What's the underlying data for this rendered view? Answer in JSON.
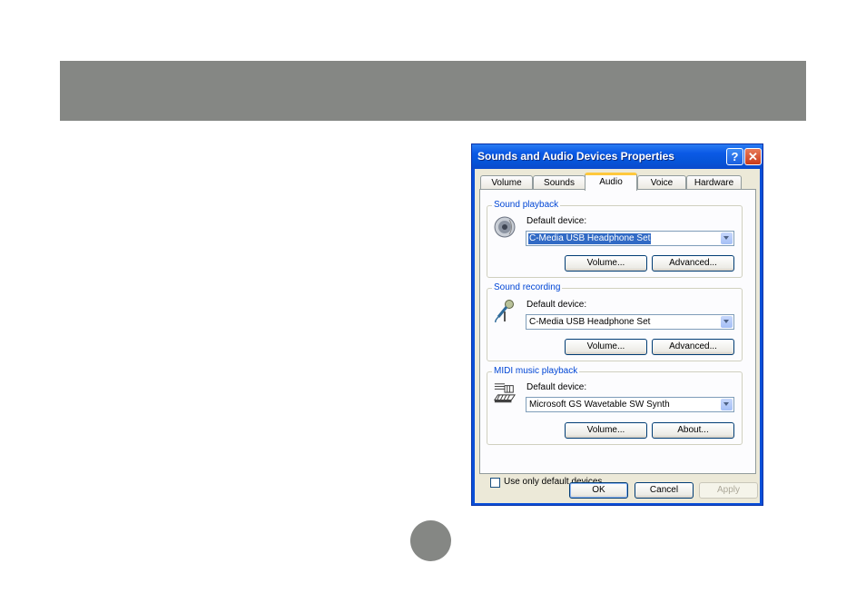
{
  "dialog": {
    "title": "Sounds and Audio Devices Properties",
    "help_label": "?",
    "close_label": "✕",
    "tabs": [
      "Volume",
      "Sounds",
      "Audio",
      "Voice",
      "Hardware"
    ],
    "active_tab": "Audio",
    "sound_playback": {
      "legend": "Sound playback",
      "icon": "speaker-icon",
      "device_label": "Default device:",
      "device_value": "C-Media USB Headphone Set",
      "button1": "Volume...",
      "button2": "Advanced..."
    },
    "sound_recording": {
      "legend": "Sound recording",
      "icon": "microphone-icon",
      "device_label": "Default device:",
      "device_value": "C-Media USB Headphone Set",
      "button1": "Volume...",
      "button2": "Advanced..."
    },
    "midi_playback": {
      "legend": "MIDI music playback",
      "icon": "midi-keyboard-icon",
      "device_label": "Default device:",
      "device_value": "Microsoft GS Wavetable SW Synth",
      "button1": "Volume...",
      "button2": "About..."
    },
    "checkbox": {
      "label": "Use only default devices",
      "checked": false
    },
    "footer": {
      "ok": "OK",
      "cancel": "Cancel",
      "apply": "Apply"
    }
  },
  "colors": {
    "banner": "#858784",
    "titlebar": "#0a4fd8",
    "selection": "#316ac5"
  }
}
